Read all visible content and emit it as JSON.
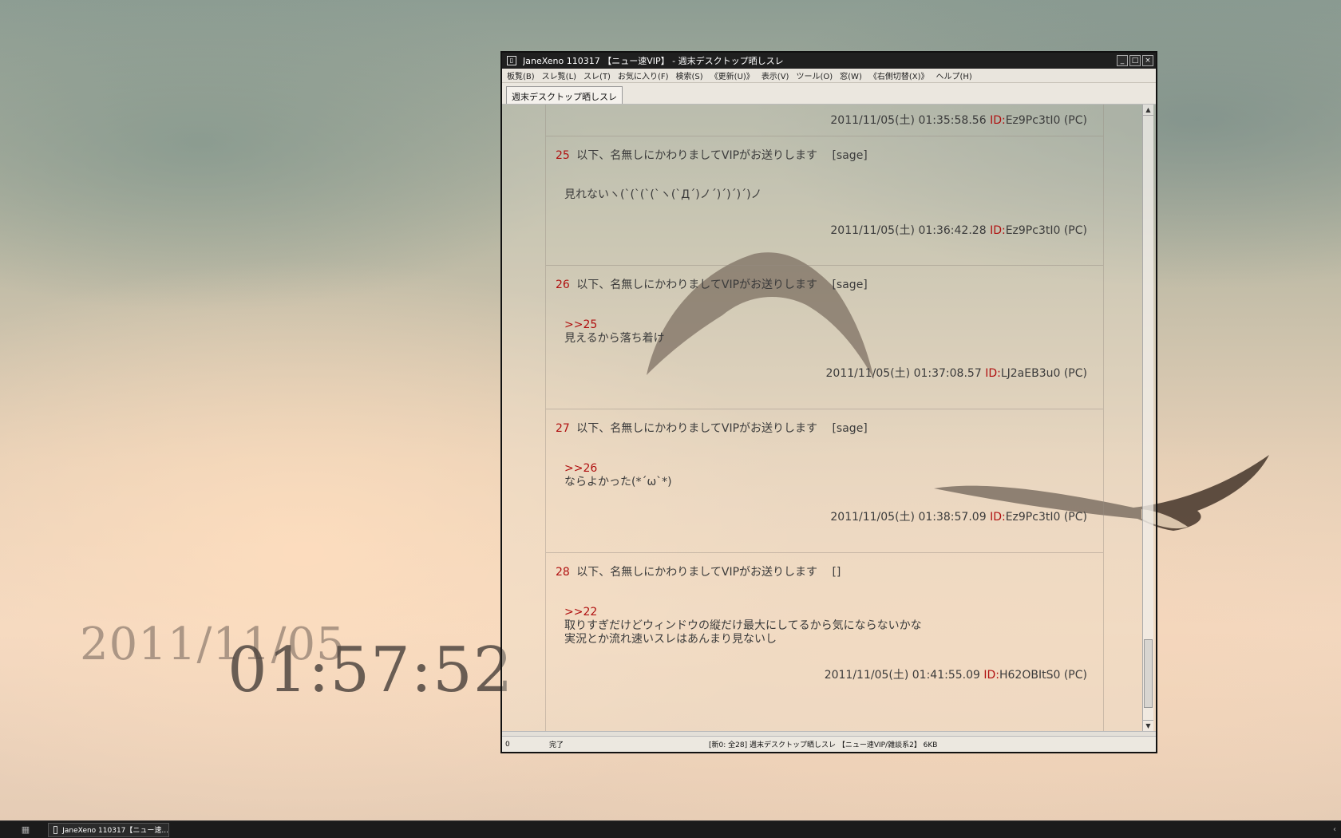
{
  "desktop": {
    "date": "2011/11/05",
    "time": "01:57:52"
  },
  "window": {
    "title": "JaneXeno 110317 【ニュー速VIP】 - 週末デスクトップ晒しスレ",
    "controls": {
      "minimize": "_",
      "maximize": "□",
      "close": "×"
    },
    "menu": [
      "板覧(B)",
      "スレ覧(L)",
      "スレ(T)",
      "お気に入り(F)",
      "検索(S)",
      "《更新(U)》",
      "表示(V)",
      "ツール(O)",
      "窓(W)",
      "《右側切替(X)》",
      "ヘルプ(H)"
    ],
    "tab": "週末デスクトップ晒しスレ",
    "posts": [
      {
        "num": "",
        "name": "",
        "mail": "",
        "anchor": "",
        "lines": [],
        "date": "2011/11/05(土) 01:35:58.56",
        "id_label": "ID:",
        "id": "Ez9Pc3tI0",
        "suffix": "(PC)"
      },
      {
        "num": "25",
        "name": "以下、名無しにかわりましてVIPがお送りします",
        "mail": "[sage]",
        "anchor": "",
        "lines": [
          "見れないヽ(`(`(`(`ヽ(`Д´)ノ´)´)´)´)ノ"
        ],
        "date": "2011/11/05(土) 01:36:42.28",
        "id_label": "ID:",
        "id": "Ez9Pc3tI0",
        "suffix": "(PC)"
      },
      {
        "num": "26",
        "name": "以下、名無しにかわりましてVIPがお送りします",
        "mail": "[sage]",
        "anchor": ">>25",
        "lines": [
          "見えるから落ち着け"
        ],
        "date": "2011/11/05(土) 01:37:08.57",
        "id_label": "ID:",
        "id": "LJ2aEB3u0",
        "suffix": "(PC)"
      },
      {
        "num": "27",
        "name": "以下、名無しにかわりましてVIPがお送りします",
        "mail": "[sage]",
        "anchor": ">>26",
        "lines": [
          "ならよかった(*´ω`*)"
        ],
        "date": "2011/11/05(土) 01:38:57.09",
        "id_label": "ID:",
        "id": "Ez9Pc3tI0",
        "suffix": "(PC)"
      },
      {
        "num": "28",
        "name": "以下、名無しにかわりましてVIPがお送りします",
        "mail": "[]",
        "anchor": ">>22",
        "lines": [
          "取りすぎだけどウィンドウの縦だけ最大にしてるから気にならないかな",
          "実況とか流れ速いスレはあんまり見ないし"
        ],
        "date": "2011/11/05(土) 01:41:55.09",
        "id_label": "ID:",
        "id": "H62OBItS0",
        "suffix": "(PC)"
      }
    ],
    "status": {
      "left": "0",
      "state": "完了",
      "info": "[新0: 全28] 週末デスクトップ晒しスレ 【ニュー速VIP/雑談系2】 6KB"
    }
  },
  "taskbar": {
    "task_label": "JaneXeno 110317【ニュー速..."
  },
  "colors": {
    "anchor_red": "#b01010",
    "post_text": "#3b3b3b",
    "titlebar": "#1f1f1f",
    "taskbar": "#1b1b1b"
  }
}
